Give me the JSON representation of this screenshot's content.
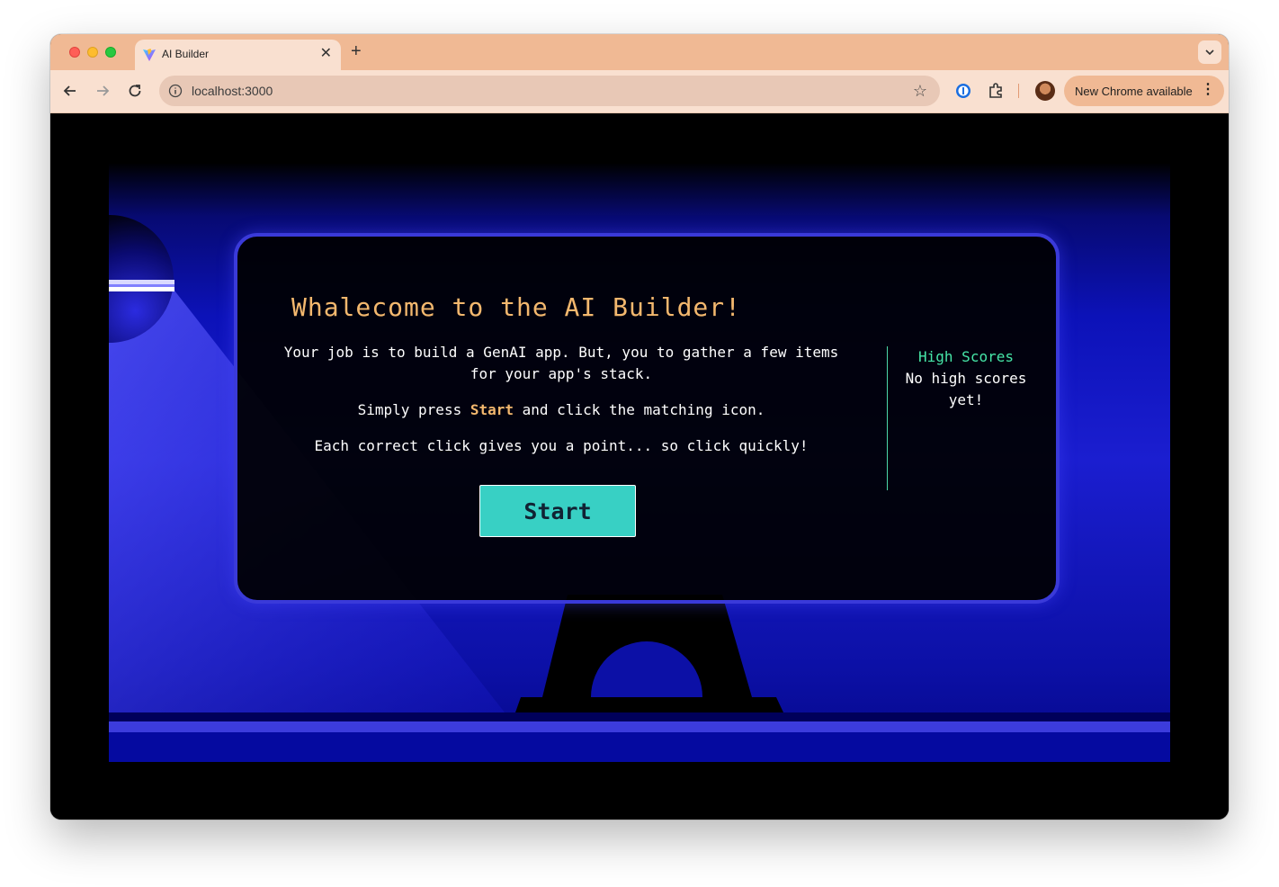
{
  "browser": {
    "tab": {
      "title": "AI Builder",
      "favicon": "vite-logo-icon"
    },
    "address": {
      "url": "localhost:3000"
    },
    "update_button": {
      "label": "New Chrome available"
    },
    "icons": [
      "back-icon",
      "forward-icon",
      "reload-icon",
      "info-icon",
      "star-icon",
      "password-manager-icon",
      "extensions-icon",
      "profile-avatar",
      "more-icon"
    ]
  },
  "game": {
    "title": "Whalecome to the AI Builder!",
    "intro_line1": "Your job is to build a GenAI app. But, you to gather a few items for your app's stack.",
    "intro_line2_pre": "Simply press ",
    "intro_line2_kw": "Start",
    "intro_line2_post": " and click the matching icon.",
    "intro_line3": "Each correct click gives you a point... so click quickly!",
    "start_label": "Start",
    "high_scores": {
      "title": "High Scores",
      "empty": "No high scores yet!"
    }
  },
  "colors": {
    "title": "#f3b86e",
    "accent_button": "#38d0c4",
    "card_border": "#3a3ad9",
    "scores_title": "#46e6a8",
    "scene_blue": "#1b1ed0"
  }
}
